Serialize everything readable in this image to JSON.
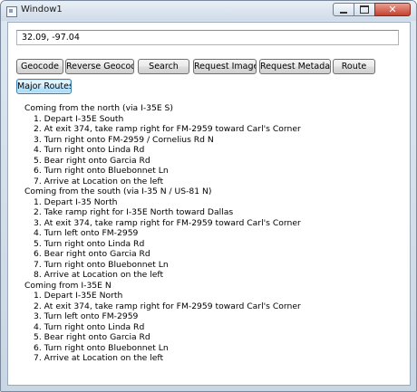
{
  "window": {
    "title": "Window1"
  },
  "input": {
    "value": "32.09, -97.04"
  },
  "buttons": [
    {
      "label": "Geocode"
    },
    {
      "label": "Reverse Geocode"
    },
    {
      "label": "Search"
    },
    {
      "label": "Request Image"
    },
    {
      "label": "Request Metadata"
    },
    {
      "label": "Route"
    }
  ],
  "major_routes_label": "Major Routes",
  "directions": [
    {
      "title": "Coming from the north (via I-35E S)",
      "steps": [
        "1. Depart I-35E South",
        "2. At exit 374, take ramp right for FM-2959 toward Carl's Corner",
        "3. Turn right onto FM-2959 / Cornelius Rd N",
        "4. Turn right onto Linda Rd",
        "5. Bear right onto Garcia Rd",
        "6. Turn right onto Bluebonnet Ln",
        "7. Arrive at Location on the left"
      ]
    },
    {
      "title": "Coming from the south (via I-35 N / US-81 N)",
      "steps": [
        "1. Depart I-35 North",
        "2. Take ramp right for I-35E North toward Dallas",
        "3. At exit 374, take ramp right for FM-2959 toward Carl's Corner",
        "4. Turn left onto FM-2959",
        "5. Turn right onto Linda Rd",
        "6. Bear right onto Garcia Rd",
        "7. Turn right onto Bluebonnet Ln",
        "8. Arrive at Location on the left"
      ]
    },
    {
      "title": "Coming from I-35E N",
      "steps": [
        "1. Depart I-35E North",
        "2. At exit 374, take ramp right for FM-2959 toward Carl's Corner",
        "3. Turn left onto FM-2959",
        "4. Turn right onto Linda Rd",
        "5. Bear right onto Garcia Rd",
        "6. Turn right onto Bluebonnet Ln",
        "7. Arrive at Location on the left"
      ]
    }
  ]
}
